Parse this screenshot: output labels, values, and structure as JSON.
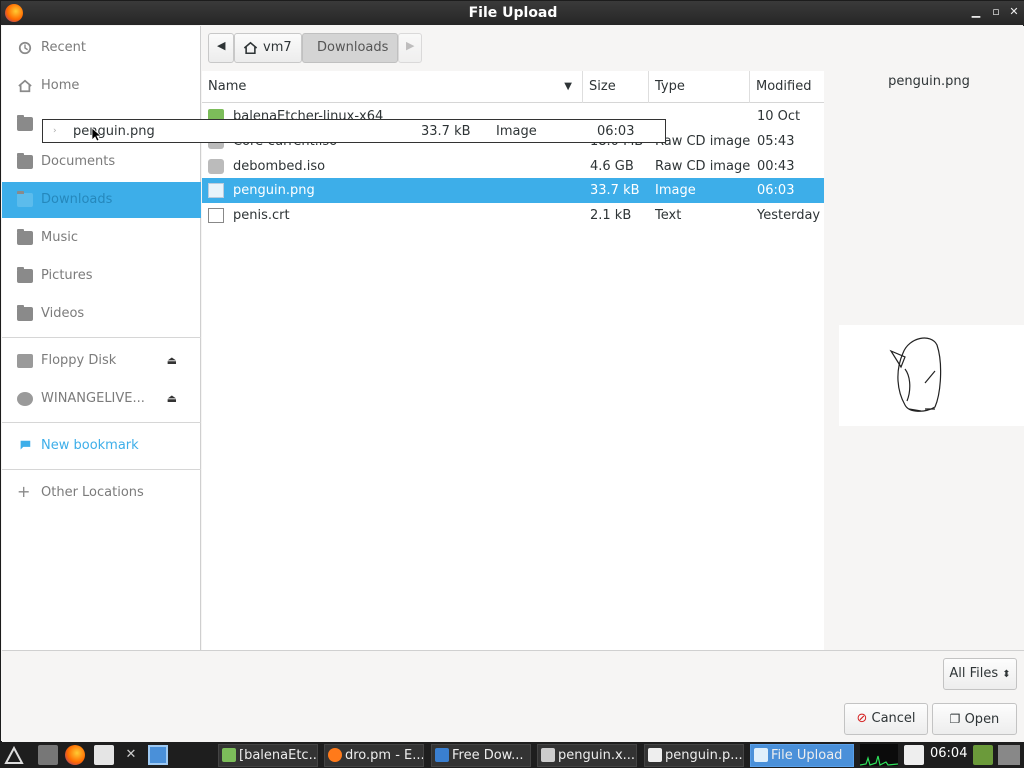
{
  "window": {
    "title": "File Upload"
  },
  "sidebar": {
    "recent": "Recent",
    "home": "Home",
    "documents": "Documents",
    "downloads": "Downloads",
    "music": "Music",
    "pictures": "Pictures",
    "videos": "Videos",
    "floppy": "Floppy Disk",
    "winange": "WINANGELIVE...",
    "new_bookmark": "New bookmark",
    "other_locations": "Other Locations"
  },
  "pathbar": {
    "home": "vm7",
    "current": "Downloads"
  },
  "columns": {
    "name": "Name",
    "size": "Size",
    "type": "Type",
    "modified": "Modified"
  },
  "files": [
    {
      "name": "balenaEtcher-linux-x64",
      "size": "",
      "type": "",
      "modified": "10 Oct",
      "icon": "folder-icon"
    },
    {
      "name": "Core-current.iso",
      "size": "18.0 MB",
      "type": "Raw CD image",
      "modified": "05:43",
      "icon": "disc-image-icon"
    },
    {
      "name": "debombed.iso",
      "size": "4.6 GB",
      "type": "Raw CD image",
      "modified": "00:43",
      "icon": "disc-image-icon"
    },
    {
      "name": "penguin.png",
      "size": "33.7 kB",
      "type": "Image",
      "modified": "06:03",
      "icon": "image-file-icon"
    },
    {
      "name": "penis.crt",
      "size": "2.1 kB",
      "type": "Text",
      "modified": "Yesterday",
      "icon": "text-file-icon"
    }
  ],
  "drag_tooltip": {
    "name": "penguin.png",
    "size": "33.7 kB",
    "type": "Image",
    "modified": "06:03"
  },
  "preview": {
    "filename": "penguin.png"
  },
  "filter": {
    "selected": "All Files"
  },
  "buttons": {
    "cancel": "Cancel",
    "open": "Open"
  },
  "taskbar": {
    "items": [
      "[balenaEtc...",
      "dro.pm - E...",
      "Free Dow...",
      "penguin.x...",
      "penguin.p...",
      "File Upload"
    ],
    "clock": "06:04"
  },
  "colors": {
    "accent": "#3daee9",
    "titlebar": "#2f2f2f",
    "taskbar": "#1e1e1e"
  }
}
